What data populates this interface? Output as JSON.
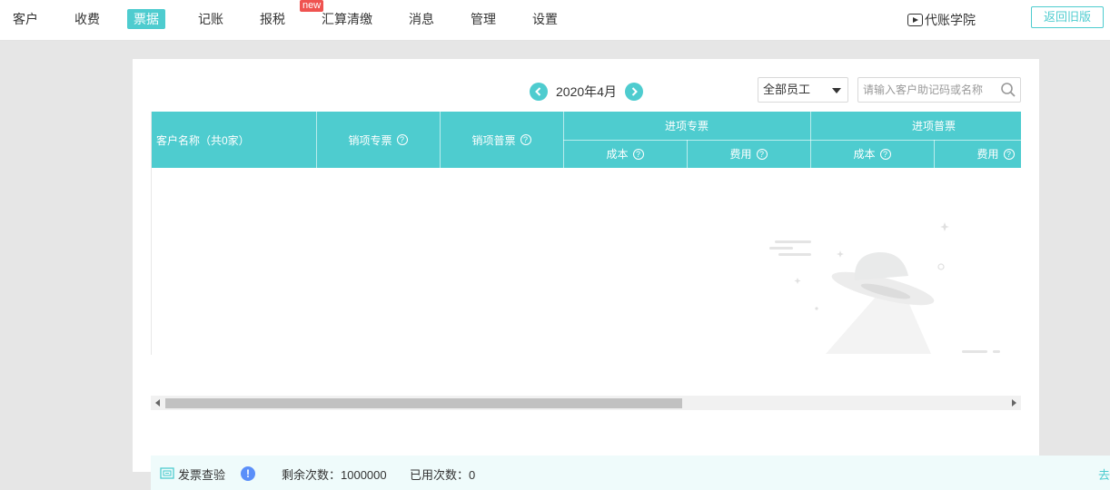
{
  "nav": {
    "items": [
      {
        "label": "客户"
      },
      {
        "label": "收费"
      },
      {
        "label": "票据"
      },
      {
        "label": "记账"
      },
      {
        "label": "报税"
      },
      {
        "label": "汇算清缴"
      },
      {
        "label": "消息"
      },
      {
        "label": "管理"
      },
      {
        "label": "设置"
      }
    ],
    "active": "票据",
    "new_badge": "new",
    "academy_label": "代账学院",
    "old_version_label": "返回旧版"
  },
  "toolbar": {
    "month": "2020年4月",
    "staff_select": "全部员工",
    "search_placeholder": "请输入客户助记码或名称"
  },
  "table": {
    "customer_col": "客户名称（共0家）",
    "sales_special": "销项专票",
    "sales_normal": "销项普票",
    "input_special": "进项专票",
    "input_normal": "进项普票",
    "cost": "成本",
    "expense": "费用",
    "help_glyph": "?"
  },
  "bottom": {
    "label": "发票查验",
    "remaining": "剩余次数：1000000",
    "used": "已用次数：0",
    "go": "去"
  },
  "colors": {
    "accent": "#4ecccf",
    "badge": "#ef5350",
    "info": "#5b8ff9"
  }
}
